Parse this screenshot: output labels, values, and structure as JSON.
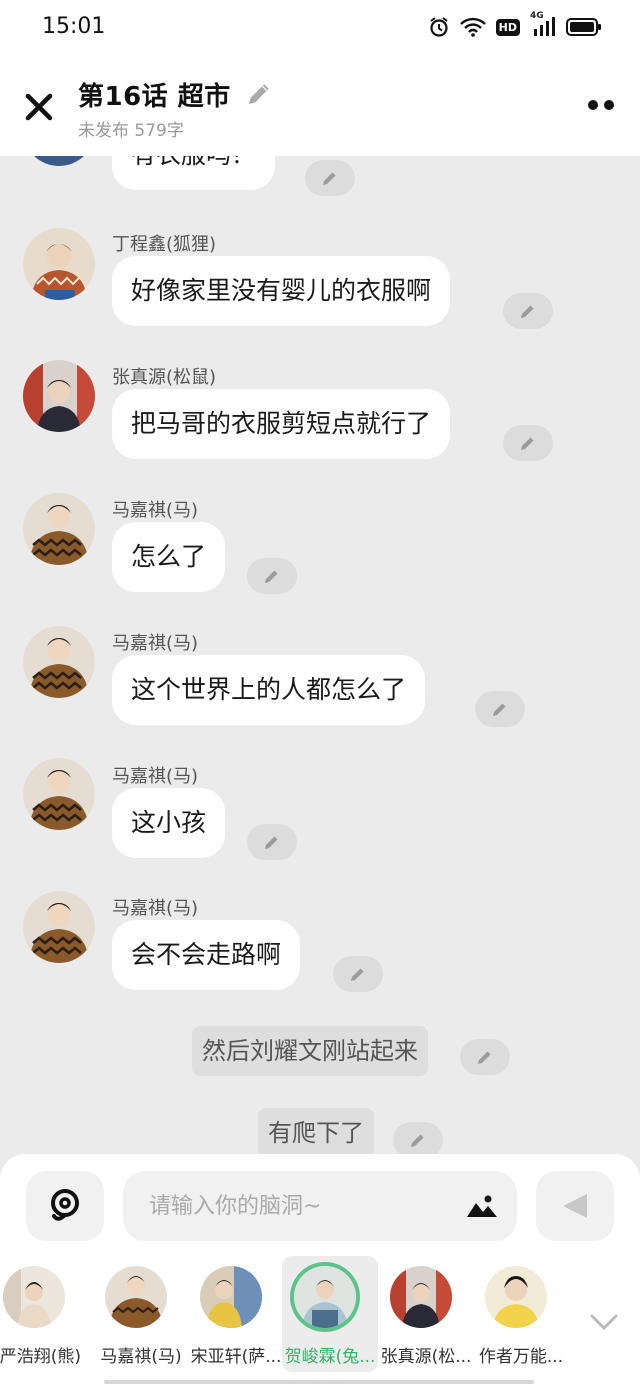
{
  "status_bar": {
    "time": "15:01",
    "hd": "HD",
    "network": "4G"
  },
  "header": {
    "title": "第16话   超市",
    "subtitle": "未发布 579字"
  },
  "messages": [
    {
      "kind": "dialog",
      "sender": "",
      "text": "有衣服吗？",
      "avatar": "avatar-jacket"
    },
    {
      "kind": "dialog",
      "sender": "丁程鑫(狐狸)",
      "text": "好像家里没有婴儿的衣服啊",
      "avatar": "avatar-sweater-orange"
    },
    {
      "kind": "dialog",
      "sender": "张真源(松鼠)",
      "text": "把马哥的衣服剪短点就行了",
      "avatar": "avatar-red-wall"
    },
    {
      "kind": "dialog",
      "sender": "马嘉祺(马)",
      "text": "怎么了",
      "avatar": "avatar-stripe-sweater"
    },
    {
      "kind": "dialog",
      "sender": "马嘉祺(马)",
      "text": "这个世界上的人都怎么了",
      "avatar": "avatar-stripe-sweater"
    },
    {
      "kind": "dialog",
      "sender": "马嘉祺(马)",
      "text": "这小孩",
      "avatar": "avatar-stripe-sweater"
    },
    {
      "kind": "dialog",
      "sender": "马嘉祺(马)",
      "text": "会不会走路啊",
      "avatar": "avatar-stripe-sweater"
    },
    {
      "kind": "narration",
      "text": "然后刘耀文刚站起来"
    },
    {
      "kind": "narration",
      "text": "有爬下了"
    }
  ],
  "composer": {
    "placeholder": "请输入你的脑洞~"
  },
  "characters": [
    {
      "name": "严浩翔(熊)",
      "active": false
    },
    {
      "name": "马嘉祺(马)",
      "active": false
    },
    {
      "name": "宋亚轩(萨...",
      "active": false
    },
    {
      "name": "贺峻霖(兔...",
      "active": true
    },
    {
      "name": "张真源(松...",
      "active": false
    },
    {
      "name": "作者万能...",
      "active": false
    }
  ],
  "colors": {
    "active_ring": "#5cc48a",
    "active_text": "#33b36a",
    "bubble": "#ffffff",
    "background": "#ebebeb"
  }
}
